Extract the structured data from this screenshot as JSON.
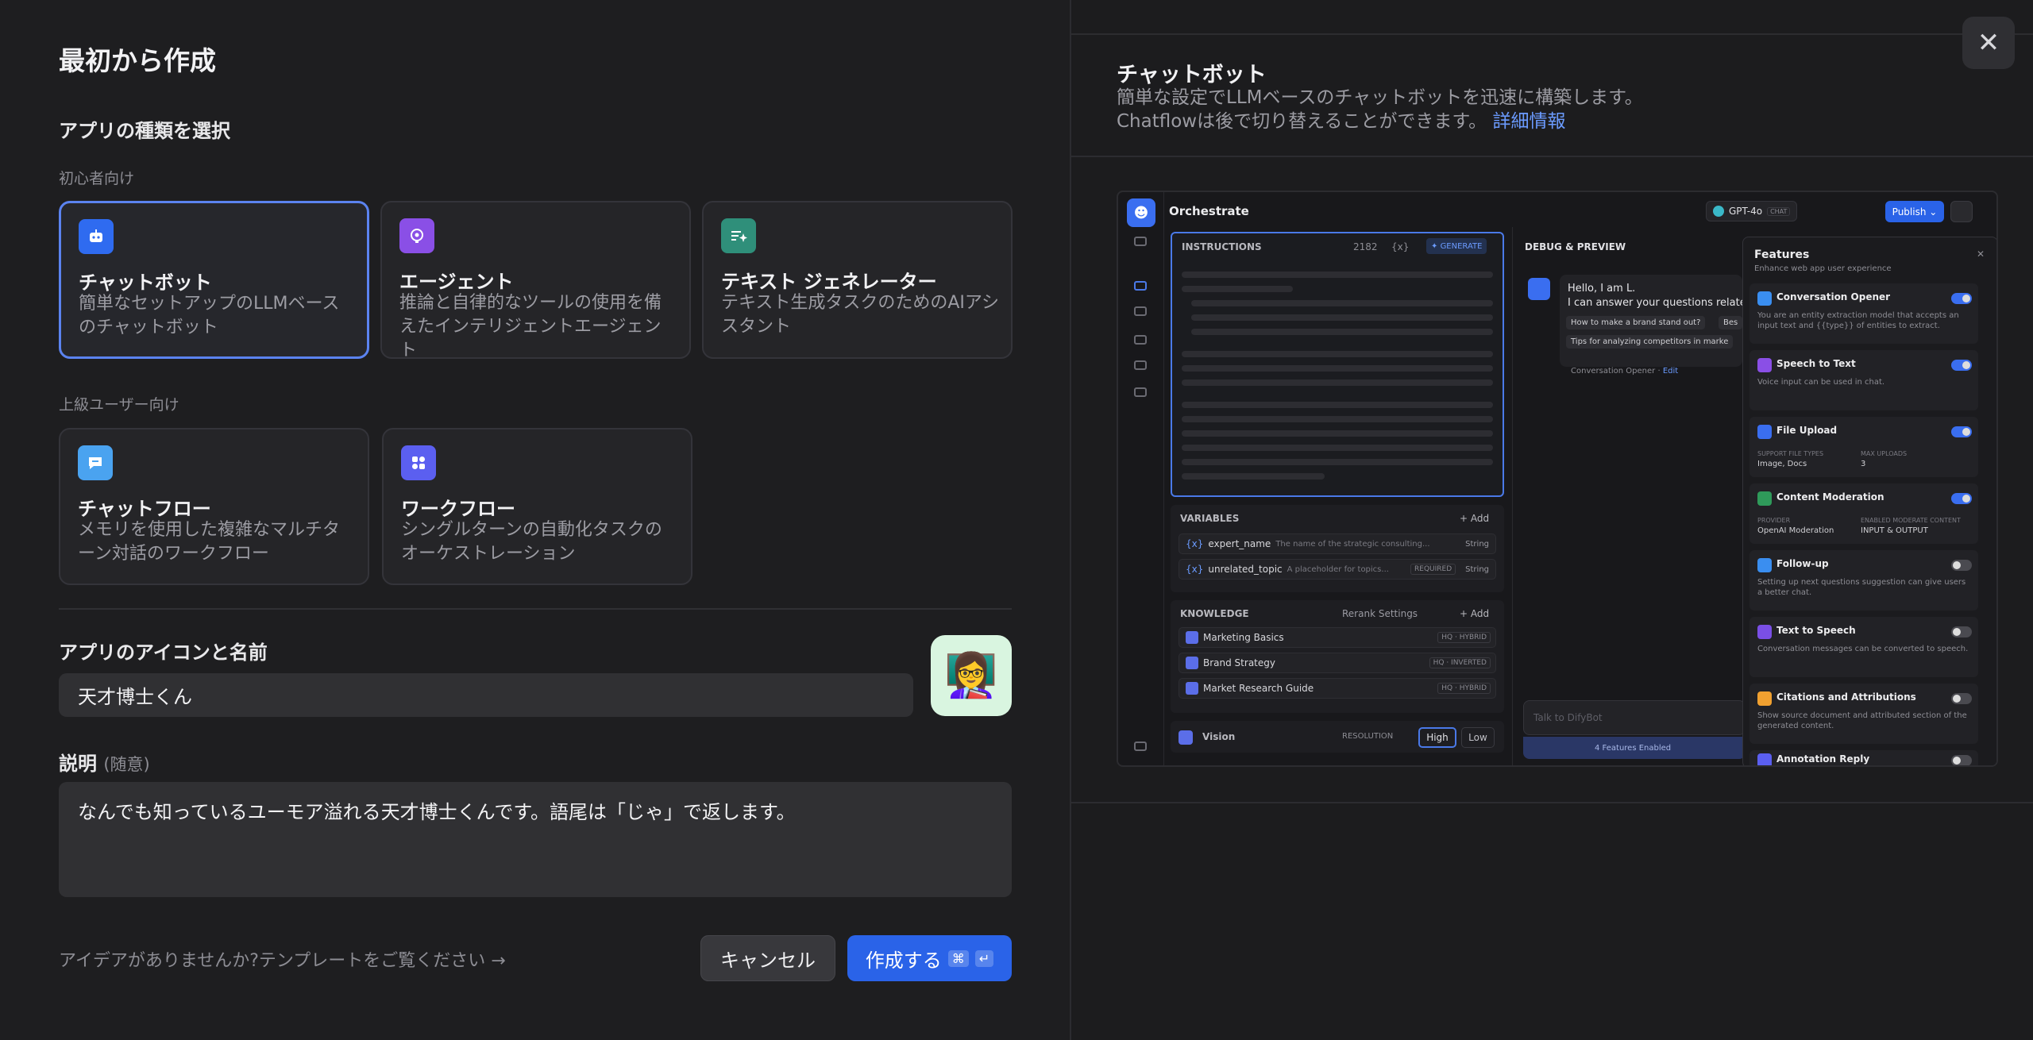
{
  "dialog": {
    "title": "最初から作成",
    "app_type_heading": "アプリの種類を選択",
    "beginner_label": "初心者向け",
    "advanced_label": "上級ユーザー向け",
    "beginner_cards": [
      {
        "name": "チャットボット",
        "desc": "簡単なセットアップのLLMベースのチャットボット",
        "icon": "chatbot-icon",
        "color": "#2f6bf0"
      },
      {
        "name": "エージェント",
        "desc": "推論と自律的なツールの使用を備えたインテリジェントエージェント",
        "icon": "agent-icon",
        "color": "#8a4fe6"
      },
      {
        "name": "テキスト ジェネレーター",
        "desc": "テキスト生成タスクのためのAIアシスタント",
        "icon": "text-generator-icon",
        "color": "#2f8f7a"
      }
    ],
    "advanced_cards": [
      {
        "name": "チャットフロー",
        "desc": "メモリを使用した複雑なマルチターン対話のワークフロー",
        "icon": "chatflow-icon",
        "color": "#4aa3f0"
      },
      {
        "name": "ワークフロー",
        "desc": "シングルターンの自動化タスクのオーケストレーション",
        "icon": "workflow-icon",
        "color": "#5b5ff0"
      }
    ],
    "icon_name_label": "アプリのアイコンと名前",
    "name_value": "天才博士くん",
    "avatar_emoji": "👩‍🏫",
    "description_label": "説明",
    "description_optional": "(随意)",
    "description_value": "なんでも知っているユーモア溢れる天才博士くんです。語尾は「じゃ」で返します。",
    "template_link": "アイデアがありませんか?テンプレートをご覧ください →",
    "cancel_label": "キャンセル",
    "create_label": "作成する",
    "create_shortcut_cmd": "⌘",
    "create_shortcut_enter": "↵"
  },
  "preview_panel": {
    "title": "チャットボット",
    "desc_line1": "簡単な設定でLLMベースのチャットボットを迅速に構築します。",
    "desc_line2": "Chatflowは後で切り替えることができます。",
    "link": "詳細情報"
  },
  "preview": {
    "orchestrate": "Orchestrate",
    "model": "GPT-4o",
    "model_tag": "CHAT",
    "publish": "Publish",
    "instructions": "INSTRUCTIONS",
    "instr_count": "2182",
    "instr_var": "{x}",
    "generate": "GENERATE",
    "variables": "VARIABLES",
    "add": "Add",
    "var_rows": [
      {
        "name": "expert_name",
        "desc": "The name of the strategic consulting...",
        "type": "String"
      },
      {
        "name": "unrelated_topic",
        "desc": "A placeholder for topics...",
        "tag": "REQUIRED",
        "type": "String"
      }
    ],
    "knowledge": "KNOWLEDGE",
    "rerank": "Rerank Settings",
    "kb_rows": [
      {
        "name": "Marketing Basics",
        "tag": "HQ · HYBRID"
      },
      {
        "name": "Brand Strategy",
        "tag": "HQ · INVERTED"
      },
      {
        "name": "Market Research Guide",
        "tag": "HQ · HYBRID"
      }
    ],
    "vision": "Vision",
    "resolution": "RESOLUTION",
    "high": "High",
    "low": "Low",
    "debug": "DEBUG & PREVIEW",
    "chat_line1": "Hello, I am L.",
    "chat_line2": "I can answer your questions related",
    "chips": [
      "How to make a brand stand out?",
      "Bes",
      "Tips for analyzing competitors in marke"
    ],
    "conv_opener": "Conversation Opener",
    "edit": "Edit",
    "input_placeholder": "Talk to DifyBot",
    "features_enabled": "4 Features Enabled",
    "features_title": "Features",
    "features_sub": "Enhance web app user experience",
    "features": [
      {
        "title": "Conversation Opener",
        "desc": "You are an entity extraction model that accepts an input text and {{type}} of entities to extract.",
        "on": true,
        "color": "#3a8ef0"
      },
      {
        "title": "Speech to Text",
        "desc": "Voice input can be used in chat.",
        "on": true,
        "color": "#8a4fe6"
      },
      {
        "title": "File Upload",
        "desc": "",
        "on": true,
        "color": "#3a6ef0",
        "meta": [
          "SUPPORT FILE TYPES",
          "Image, Docs",
          "MAX UPLOADS",
          "3"
        ]
      },
      {
        "title": "Content Moderation",
        "desc": "",
        "on": true,
        "color": "#2f9a5a",
        "meta": [
          "PROVIDER",
          "OpenAI Moderation",
          "ENABLED MODERATE CONTENT",
          "INPUT & OUTPUT"
        ]
      },
      {
        "title": "Follow-up",
        "desc": "Setting up next questions suggestion can give users a better chat.",
        "on": false,
        "color": "#3a8ef0"
      },
      {
        "title": "Text to Speech",
        "desc": "Conversation messages can be converted to speech.",
        "on": false,
        "color": "#7a4fe6"
      },
      {
        "title": "Citations and Attributions",
        "desc": "Show source document and attributed section of the generated content.",
        "on": false,
        "color": "#f0a030"
      },
      {
        "title": "Annotation Reply",
        "desc": "",
        "on": false,
        "color": "#5b5ff0"
      }
    ]
  }
}
